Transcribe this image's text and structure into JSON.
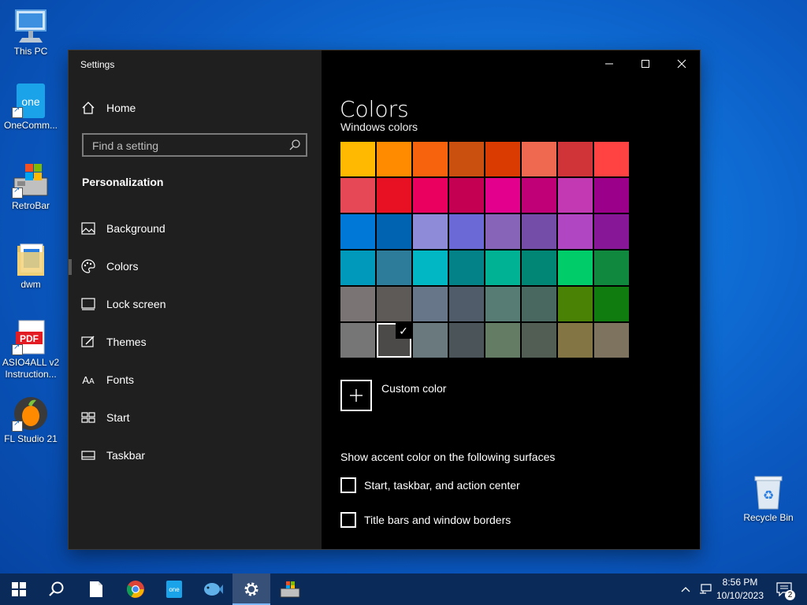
{
  "desktop": {
    "icons": [
      {
        "label": "This PC",
        "icon": "this-pc-icon"
      },
      {
        "label": "OneComm...",
        "icon": "onecommander-icon"
      },
      {
        "label": "RetroBar",
        "icon": "retrobar-icon"
      },
      {
        "label": "dwm",
        "icon": "folder-icon"
      },
      {
        "label": "ASIO4ALL v2 Instruction...",
        "line1": "ASIO4ALL v2",
        "line2": "Instruction...",
        "icon": "pdf-icon",
        "badge": "PDF"
      },
      {
        "label": "FL Studio 21",
        "icon": "fl-studio-icon"
      },
      {
        "label": "Recycle Bin",
        "icon": "recycle-bin-icon"
      }
    ]
  },
  "window": {
    "app_title": "Settings",
    "sidebar": {
      "home_label": "Home",
      "search_placeholder": "Find a setting",
      "section_title": "Personalization",
      "items": [
        {
          "label": "Background",
          "icon": "picture-icon"
        },
        {
          "label": "Colors",
          "icon": "palette-icon",
          "active": true
        },
        {
          "label": "Lock screen",
          "icon": "lock-screen-icon"
        },
        {
          "label": "Themes",
          "icon": "themes-icon"
        },
        {
          "label": "Fonts",
          "icon": "fonts-icon",
          "glyph": "A"
        },
        {
          "label": "Start",
          "icon": "start-icon"
        },
        {
          "label": "Taskbar",
          "icon": "taskbar-icon"
        }
      ]
    },
    "main": {
      "title": "Colors",
      "subtitle": "Windows colors",
      "swatch_colors": [
        "#FFB900",
        "#FF8C00",
        "#F7630C",
        "#CA5010",
        "#DA3B01",
        "#EF6950",
        "#D13438",
        "#FF4343",
        "#E74856",
        "#E81123",
        "#EA005E",
        "#C30052",
        "#E3008C",
        "#BF0077",
        "#C239B3",
        "#9A0089",
        "#0078D7",
        "#0063B1",
        "#8E8CD8",
        "#6B69D6",
        "#8764B8",
        "#744DA9",
        "#B146C2",
        "#881798",
        "#0099BC",
        "#2D7D9A",
        "#00B7C3",
        "#038387",
        "#00B294",
        "#018574",
        "#00CC6A",
        "#10893E",
        "#7A7574",
        "#5D5A58",
        "#68768A",
        "#515C6B",
        "#567C73",
        "#486860",
        "#498205",
        "#107C10",
        "#767676",
        "#4C4A48",
        "#69797E",
        "#4A5459",
        "#647C64",
        "#525E54",
        "#847545",
        "#7E735F"
      ],
      "selected_index": 41,
      "check_glyph": "✓",
      "custom_color_label": "Custom color",
      "surfaces_title": "Show accent color on the following surfaces",
      "checkboxes": [
        {
          "label": "Start, taskbar, and action center",
          "checked": false
        },
        {
          "label": "Title bars and window borders",
          "checked": false
        }
      ]
    }
  },
  "taskbar": {
    "apps": [
      "start-icon",
      "search-icon",
      "file-icon",
      "chrome-icon",
      "onecommander-icon",
      "fish-app-icon",
      "settings-gear-icon",
      "retrobar-icon"
    ],
    "active_app": "settings-gear-icon",
    "time": "8:56 PM",
    "date": "10/10/2023",
    "notification_count": "2"
  }
}
